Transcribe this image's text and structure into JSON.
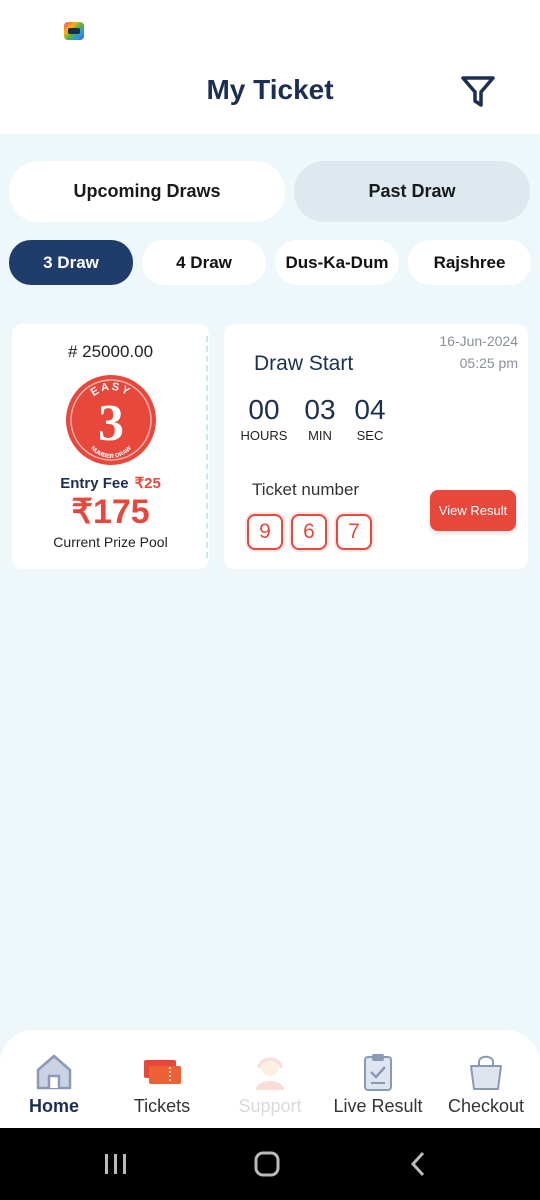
{
  "header": {
    "title": "My Ticket",
    "filter_icon": "filter-icon"
  },
  "tabs": [
    {
      "label": "Upcoming Draws",
      "active": true
    },
    {
      "label": "Past Draw",
      "active": false
    }
  ],
  "chips": [
    {
      "label": "3 Draw",
      "active": true
    },
    {
      "label": "4 Draw",
      "active": false
    },
    {
      "label": "Dus-Ka-Dum",
      "active": false
    },
    {
      "label": "Rajshree",
      "active": false
    }
  ],
  "ticket": {
    "prize_id": "# 25000.00",
    "logo_text": "EASY",
    "logo_digit": "3",
    "logo_subtext": "NUMBER DRAW",
    "entry_fee_label": "Entry Fee",
    "entry_fee_amount": "₹25",
    "prize_amount": "₹175",
    "prize_label": "Current Prize Pool",
    "date": "16-Jun-2024",
    "time": "05:25 pm",
    "draw_start_label": "Draw Start",
    "timer": [
      {
        "value": "00",
        "label": "HOURS"
      },
      {
        "value": "03",
        "label": "MIN"
      },
      {
        "value": "04",
        "label": "SEC"
      }
    ],
    "ticket_number_label": "Ticket number",
    "ticket_digits": [
      "9",
      "6",
      "7"
    ],
    "view_result_label": "View Result"
  },
  "bottom_nav": [
    {
      "label": "Home",
      "icon": "home-icon",
      "active": true
    },
    {
      "label": "Tickets",
      "icon": "tickets-icon",
      "active": false
    },
    {
      "label": "Support",
      "icon": "support-icon",
      "active": false
    },
    {
      "label": "Live Result",
      "icon": "clipboard-icon",
      "active": false
    },
    {
      "label": "Checkout",
      "icon": "shopping-bag-icon",
      "active": false
    }
  ],
  "colors": {
    "primary": "#1f3c6a",
    "accent": "#e8473b",
    "background": "#eef8fb"
  }
}
